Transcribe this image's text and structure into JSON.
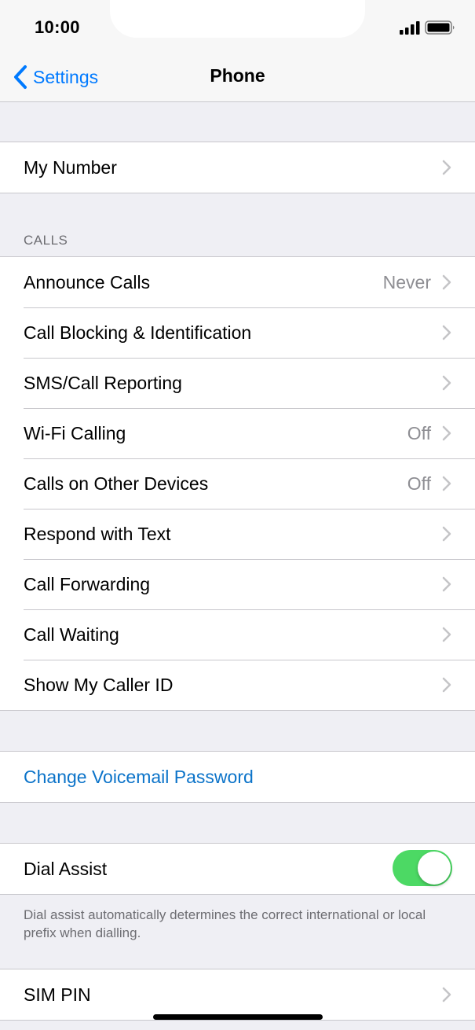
{
  "status_bar": {
    "time": "10:00"
  },
  "nav": {
    "back_label": "Settings",
    "title": "Phone"
  },
  "my_number": {
    "label": "My Number"
  },
  "calls_section": {
    "header": "CALLS",
    "items": [
      {
        "label": "Announce Calls",
        "value": "Never"
      },
      {
        "label": "Call Blocking & Identification",
        "value": ""
      },
      {
        "label": "SMS/Call Reporting",
        "value": ""
      },
      {
        "label": "Wi-Fi Calling",
        "value": "Off"
      },
      {
        "label": "Calls on Other Devices",
        "value": "Off"
      },
      {
        "label": "Respond with Text",
        "value": ""
      },
      {
        "label": "Call Forwarding",
        "value": ""
      },
      {
        "label": "Call Waiting",
        "value": ""
      },
      {
        "label": "Show My Caller ID",
        "value": ""
      }
    ]
  },
  "voicemail": {
    "label": "Change Voicemail Password"
  },
  "dial_assist": {
    "label": "Dial Assist",
    "enabled": true,
    "description": "Dial assist automatically determines the correct international or local prefix when dialling."
  },
  "sim_pin": {
    "label": "SIM PIN"
  },
  "colors": {
    "accent": "#007aff",
    "toggle_on": "#4cd964",
    "background": "#efeff4",
    "separator": "#c8c7cc",
    "secondary_text": "#8e8e93"
  },
  "icons": [
    "signal-icon",
    "battery-icon",
    "back-chevron-icon",
    "chevron-icon"
  ]
}
